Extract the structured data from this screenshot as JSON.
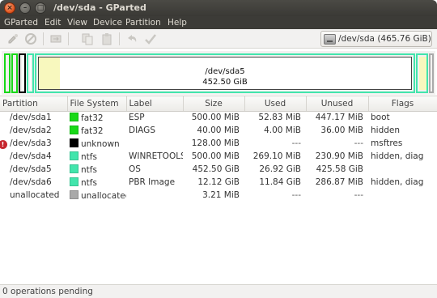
{
  "window": {
    "title": "/dev/sda - GParted"
  },
  "menubar": {
    "items": [
      "GParted",
      "Edit",
      "View",
      "Device",
      "Partition",
      "Help"
    ]
  },
  "toolbar": {
    "icons": [
      "new-icon",
      "delete-icon",
      "resize-icon",
      "copy-icon",
      "paste-icon",
      "undo-icon",
      "apply-icon"
    ]
  },
  "device": {
    "label": "/dev/sda  (465.76 GiB)"
  },
  "diskmap": {
    "selected_name": "/dev/sda5",
    "selected_size": "452.50 GiB"
  },
  "table": {
    "columns": [
      "Partition",
      "File System",
      "Label",
      "Size",
      "Used",
      "Unused",
      "Flags"
    ],
    "rows": [
      {
        "partition": "/dev/sda1",
        "fs": "fat32",
        "fs_color": "#18d918",
        "label": "ESP",
        "size": "500.00 MiB",
        "used": "52.83 MiB",
        "unused": "447.17 MiB",
        "flags": "boot",
        "warn": false
      },
      {
        "partition": "/dev/sda2",
        "fs": "fat32",
        "fs_color": "#18d918",
        "label": "DIAGS",
        "size": "40.00 MiB",
        "used": "4.00 MiB",
        "unused": "36.00 MiB",
        "flags": "hidden",
        "warn": false
      },
      {
        "partition": "/dev/sda3",
        "fs": "unknown",
        "fs_color": "#000000",
        "label": "",
        "size": "128.00 MiB",
        "used": "---",
        "unused": "---",
        "flags": "msftres",
        "warn": true
      },
      {
        "partition": "/dev/sda4",
        "fs": "ntfs",
        "fs_color": "#42e5ac",
        "label": "WINRETOOLS",
        "size": "500.00 MiB",
        "used": "269.10 MiB",
        "unused": "230.90 MiB",
        "flags": "hidden, diag",
        "warn": false
      },
      {
        "partition": "/dev/sda5",
        "fs": "ntfs",
        "fs_color": "#42e5ac",
        "label": "OS",
        "size": "452.50 GiB",
        "used": "26.92 GiB",
        "unused": "425.58 GiB",
        "flags": "",
        "warn": false
      },
      {
        "partition": "/dev/sda6",
        "fs": "ntfs",
        "fs_color": "#42e5ac",
        "label": "PBR Image",
        "size": "12.12 GiB",
        "used": "11.84 GiB",
        "unused": "286.87 MiB",
        "flags": "hidden, diag",
        "warn": false
      },
      {
        "partition": "unallocated",
        "fs": "unallocated",
        "fs_color": "#a9a9a9",
        "label": "",
        "size": "3.21 MiB",
        "used": "---",
        "unused": "---",
        "flags": "",
        "warn": false
      }
    ]
  },
  "colors": {
    "fat32": "#18d918",
    "ntfs": "#42e5ac",
    "unknown": "#000000",
    "unallocated": "#a9a9a9",
    "used_space": "#f8f8be"
  },
  "status": {
    "text": "0 operations pending"
  }
}
